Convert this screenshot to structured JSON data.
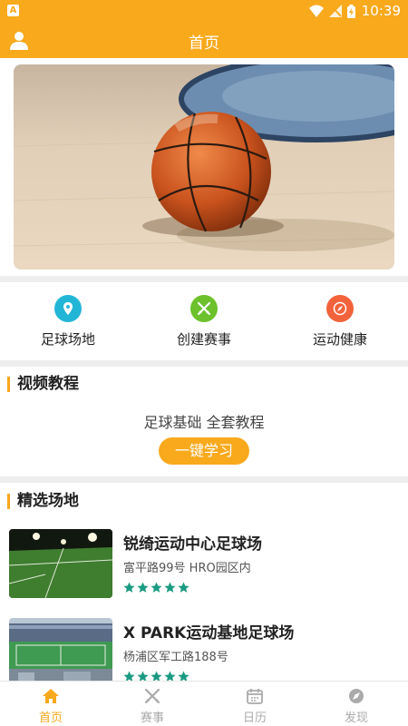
{
  "status_bar": {
    "time": "10:39",
    "sim_label": "A"
  },
  "header": {
    "title": "首页"
  },
  "quick_links": [
    {
      "label": "足球场地",
      "icon": "map-pin-icon",
      "color": "#22b6d6"
    },
    {
      "label": "创建赛事",
      "icon": "crossed-swords-icon",
      "color": "#6cc12c"
    },
    {
      "label": "运动健康",
      "icon": "compass-icon",
      "color": "#f2623b"
    }
  ],
  "video_section": {
    "title": "视频教程",
    "subtitle": "足球基础  全套教程",
    "button_label": "一键学习"
  },
  "venues_section": {
    "title": "精选场地",
    "items": [
      {
        "name": "锐绮运动中心足球场",
        "address": "富平路99号 HRO园区内",
        "rating": 5
      },
      {
        "name": "X PARK运动基地足球场",
        "address": "杨浦区军工路188号",
        "rating": 5
      }
    ]
  },
  "tab_bar": {
    "tabs": [
      {
        "label": "首页",
        "icon": "home-icon",
        "active": true
      },
      {
        "label": "赛事",
        "icon": "crossed-swords-icon",
        "active": false
      },
      {
        "label": "日历",
        "icon": "calendar-icon",
        "active": false
      },
      {
        "label": "发现",
        "icon": "compass-icon",
        "active": false
      }
    ]
  },
  "colors": {
    "accent": "#f8a91c",
    "star": "#1a9a82"
  }
}
